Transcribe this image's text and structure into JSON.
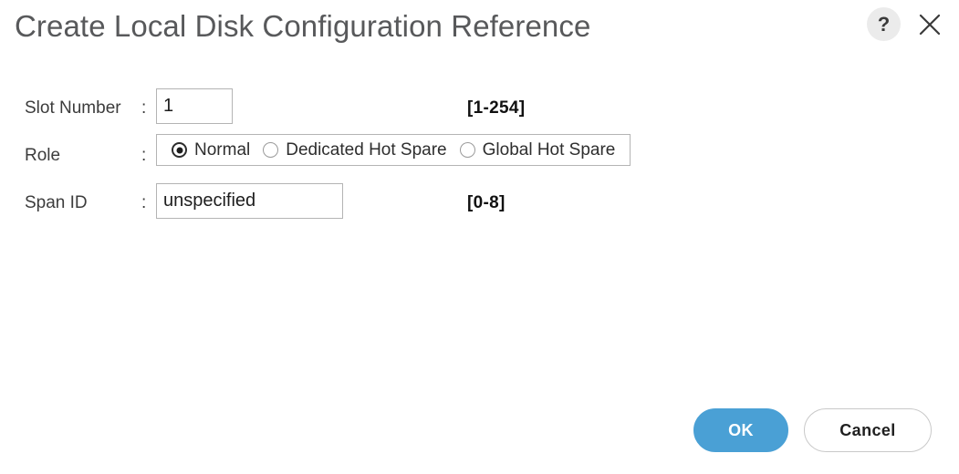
{
  "dialog": {
    "title": "Create Local Disk Configuration Reference",
    "help_icon": "question-mark-icon",
    "help_label": "?",
    "close_icon": "close-icon"
  },
  "form": {
    "slot_number": {
      "label": "Slot Number",
      "colon": ":",
      "value": "1",
      "placeholder": "",
      "hint": "[1-254]"
    },
    "role": {
      "label": "Role",
      "colon": ":",
      "options": [
        {
          "label": "Normal",
          "selected": true
        },
        {
          "label": "Dedicated Hot Spare",
          "selected": false
        },
        {
          "label": "Global Hot Spare",
          "selected": false
        }
      ]
    },
    "span_id": {
      "label": "Span ID",
      "colon": ":",
      "value": "unspecified",
      "placeholder": "",
      "hint": "[0-8]"
    }
  },
  "footer": {
    "ok_label": "OK",
    "cancel_label": "Cancel"
  },
  "colors": {
    "primary": "#4aa0d5",
    "title_text": "#58595b",
    "border": "#b4b4b4",
    "help_bg": "#ebebeb"
  }
}
